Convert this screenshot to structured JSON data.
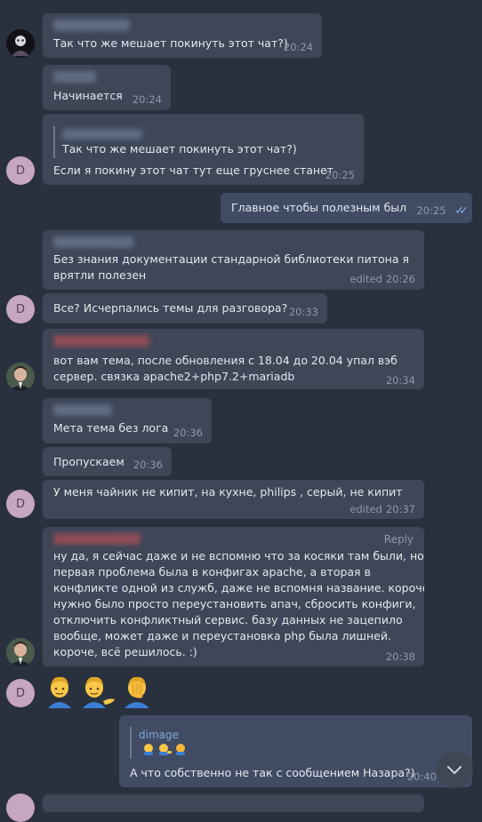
{
  "messages": {
    "m1": {
      "text": "Так что же мешает покинуть этот чат?)",
      "time": "20:24"
    },
    "m2": {
      "text": "Начинается",
      "time": "20:24"
    },
    "m3": {
      "reply_text": "Так что же мешает покинуть этот чат?)",
      "text": "Если я покину этот чат тут еще груснее станет",
      "time": "20:25"
    },
    "m4": {
      "text": "Главное чтобы полезным был",
      "time": "20:25",
      "status": "read"
    },
    "m5": {
      "line1": "Без знания документации стандарной библиотеки питона я",
      "line2": "врятли полезен",
      "edited": "edited",
      "time": "20:26"
    },
    "m6": {
      "text": "Все? Исчерпались темы для разговора?",
      "time": "20:33"
    },
    "m7": {
      "line1": "вот вам тема, после обновления с 18.04 до 20.04 упал вэб",
      "line2": "сервер. связка apache2+php7.2+mariadb",
      "time": "20:34"
    },
    "m8": {
      "text": "Мета тема без лога",
      "time": "20:36"
    },
    "m9": {
      "text": "Пропускаем",
      "time": "20:36"
    },
    "m10": {
      "text": "У меня чайник не кипит, на кухне, philips , серый, не кипит",
      "edited": "edited",
      "time": "20:37"
    },
    "m11": {
      "reply_label": "Reply",
      "lines": [
        "ну да, я сейчас даже и не вспомню что за косяки там были, но",
        "первая проблема была в конфигах apache, а вторая в",
        "конфликте одной из служб, даже не вспомня название. короче,",
        "нужно было просто переустановить апач, сбросить конфиги,",
        "отключить конфликтный сервис. базу данных не зацепило",
        "вообще, может даже и переустановка php была лишней.",
        "короче, всё решилось. :)"
      ],
      "time": "20:38"
    },
    "m12": {
      "emojis": [
        "man",
        "man-tipping-hand",
        "man-facepalming"
      ]
    },
    "m13": {
      "reply_name": "dimage",
      "text": "А что собственно не так с сообщением Назара?)",
      "time": "20:40"
    }
  },
  "avatars": {
    "letter": "D",
    "colors": {
      "d_avatar": "#c7a6bf",
      "bubble_in": "#3e4658",
      "bubble_out": "#414c64",
      "background": "#2a313e"
    }
  },
  "icons": {
    "read_status": "double-check-icon",
    "scroll_down": "chevron-down-icon"
  }
}
